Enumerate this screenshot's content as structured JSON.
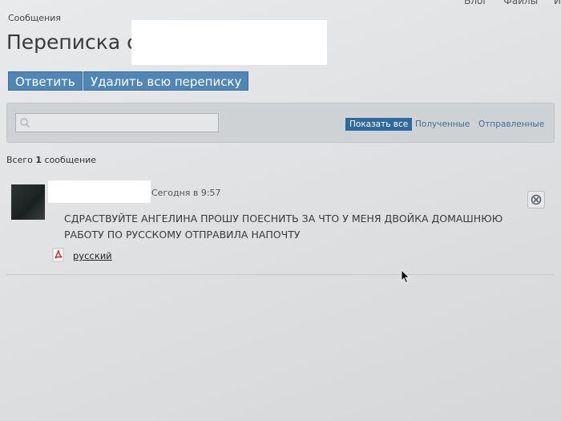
{
  "top_nav": [
    "Блог",
    "Файлы",
    "И"
  ],
  "breadcrumb": "Сообщения",
  "page_title": "Переписка с",
  "actions": {
    "reply": "Ответить",
    "delete_all": "Удалить всю переписку"
  },
  "filters": {
    "show_all": "Показать все",
    "received": "Полученные",
    "sent": "Отправленные"
  },
  "summary": {
    "prefix": "Всего",
    "count": "1",
    "suffix": "сообщение"
  },
  "message": {
    "time": "Сегодня в 9:57",
    "text": "СДРАСТВУЙТЕ АНГЕЛИНА ПРОШУ ПОЕСНИТЬ ЗА ЧТО У МЕНЯ ДВОЙКА ДОМАШНЮЮ РАБОТУ ПО РУССКОМУ ОТПРАВИЛА НАПОЧТУ",
    "attachment": "русский"
  },
  "colors": {
    "accent": "#4f86b5",
    "active_filter": "#2f6a9c",
    "link": "#3f6e96"
  }
}
